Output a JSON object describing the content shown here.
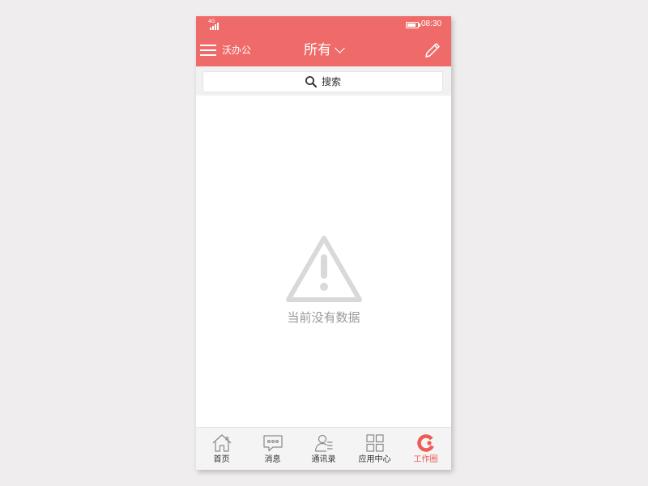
{
  "status_bar": {
    "network": "4G",
    "time": "08:30"
  },
  "header": {
    "app_name": "沃办公",
    "filter_label": "所有"
  },
  "search": {
    "label": "搜索"
  },
  "empty_state": {
    "message": "当前没有数据"
  },
  "tabs": [
    {
      "label": "首页",
      "icon": "home-icon",
      "active": false
    },
    {
      "label": "消息",
      "icon": "message-icon",
      "active": false
    },
    {
      "label": "通讯录",
      "icon": "contacts-icon",
      "active": false
    },
    {
      "label": "应用中心",
      "icon": "apps-grid-icon",
      "active": false
    },
    {
      "label": "工作圈",
      "icon": "work-circle-icon",
      "active": true
    }
  ],
  "colors": {
    "accent": "#ef6b69",
    "active_tab": "#ef5a57",
    "empty_icon": "#d9d9d9",
    "empty_text": "#9a9a9a",
    "tab_icon": "#8a8a8a"
  }
}
